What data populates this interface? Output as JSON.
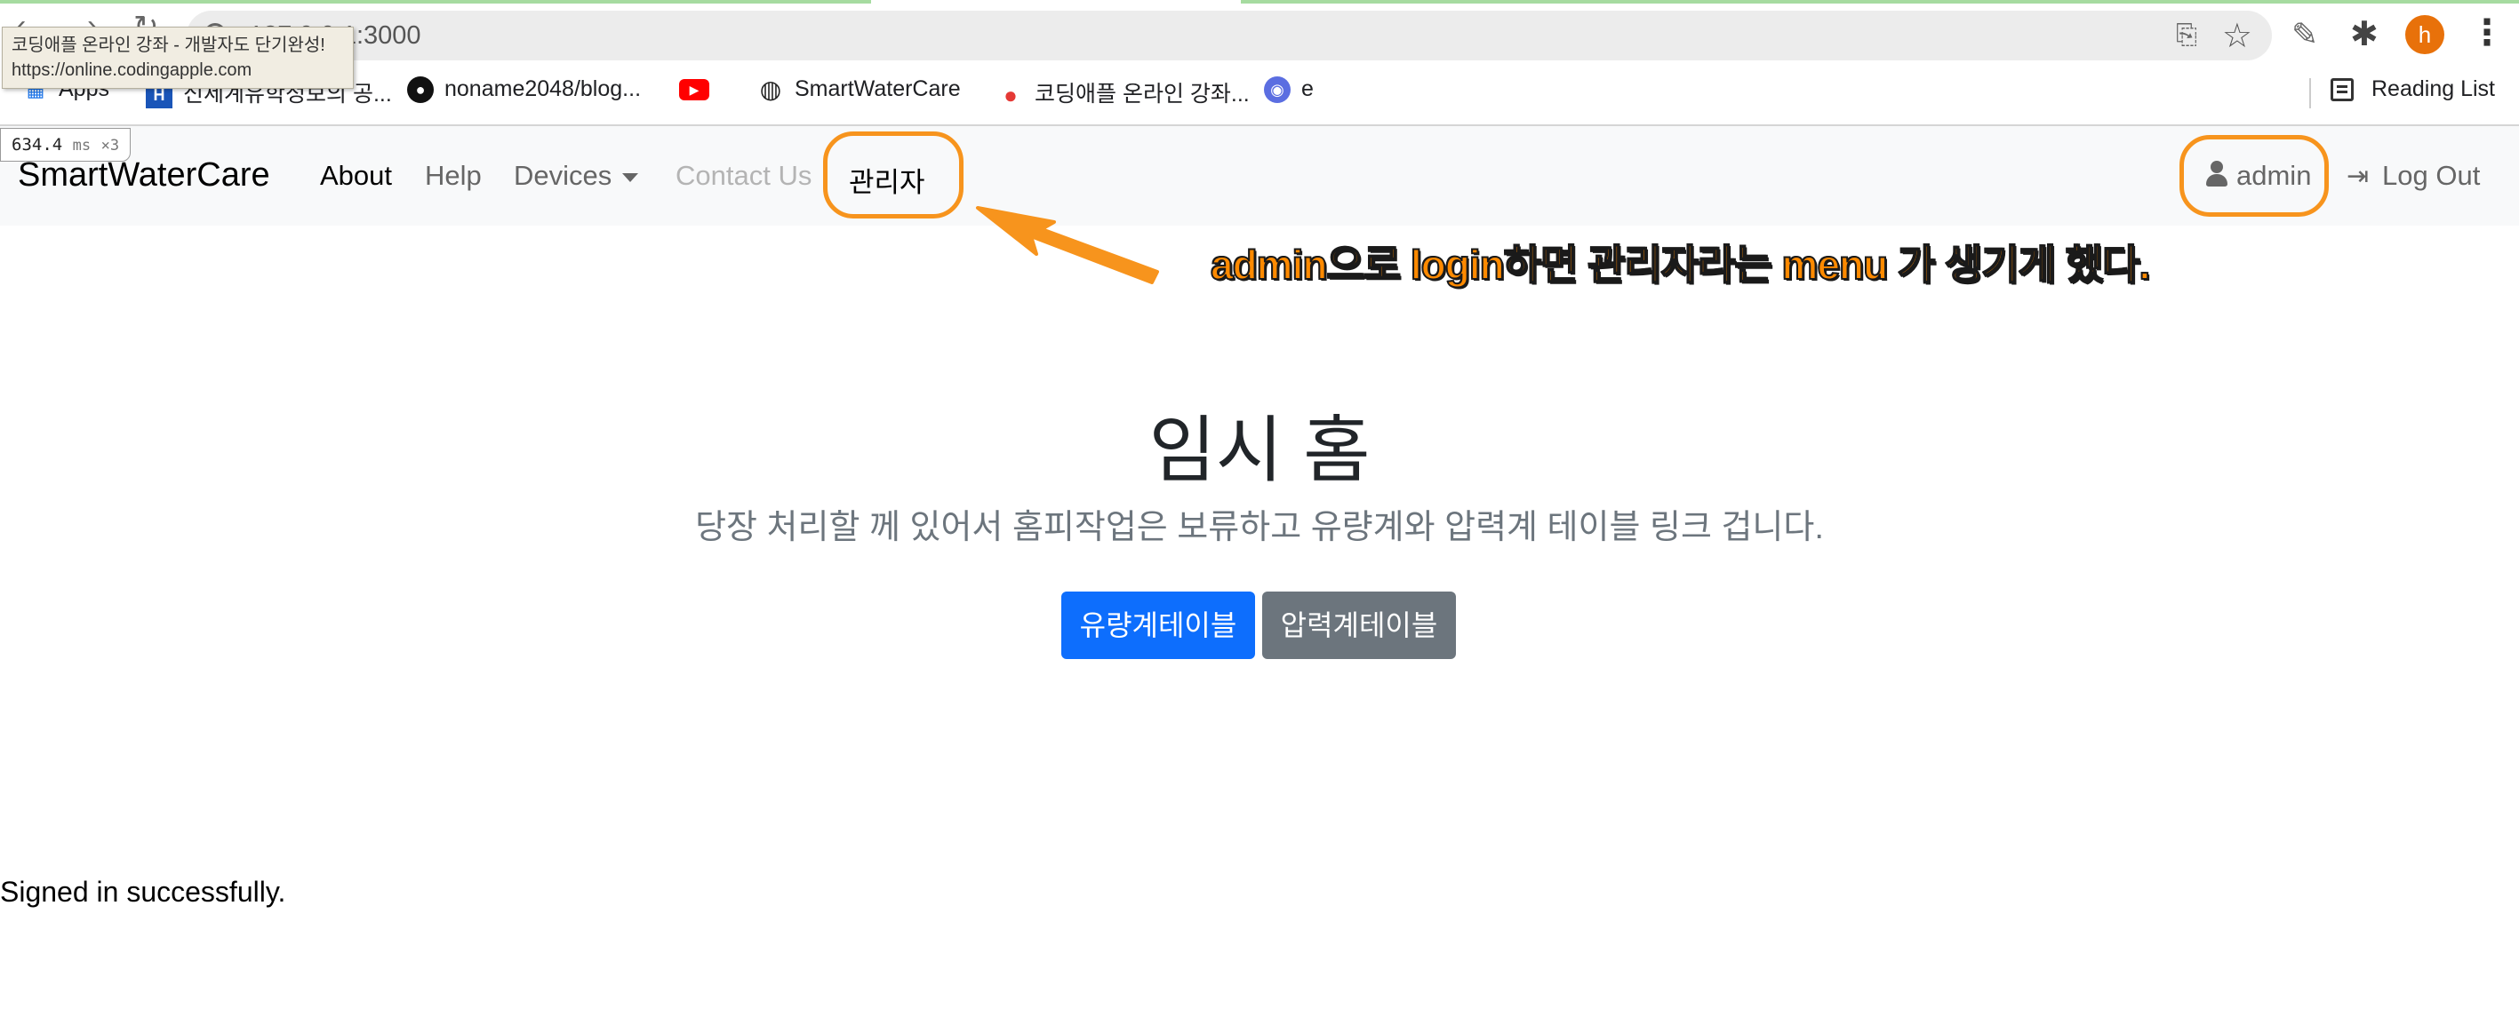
{
  "browser": {
    "address": "127.0.0.1:3000",
    "icons": [
      "back-icon",
      "forward-icon",
      "reload-icon",
      "info-icon",
      "translate-icon",
      "star-icon",
      "eyedropper-icon",
      "extensions-icon",
      "kebab-menu-icon"
    ],
    "profile_initial": "h",
    "profile_color": "#e8710a"
  },
  "tooltip": {
    "title": "코딩애플 온라인 강좌 - 개발자도 단기완성!",
    "url": "https://online.codingapple.com"
  },
  "perf": {
    "value": "634.4",
    "unit": "ms",
    "count": "×3"
  },
  "bookmarks": {
    "items": [
      {
        "label": "Apps",
        "icon": "apps-icon"
      },
      {
        "label": "신세계유학정보의 공...",
        "icon": "school-icon"
      },
      {
        "label": "noname2048/blog...",
        "icon": "github-icon"
      },
      {
        "label": "",
        "icon": "youtube-icon"
      },
      {
        "label": "SmartWaterCare",
        "icon": "globe-icon"
      },
      {
        "label": "코딩애플 온라인 강좌...",
        "icon": "apple-icon"
      },
      {
        "label": "e",
        "icon": "location-icon"
      }
    ],
    "reading_list": "Reading List"
  },
  "navbar": {
    "brand": "SmartWaterCare",
    "links": {
      "about": "About",
      "help": "Help",
      "devices": "Devices",
      "contact": "Contact Us",
      "admin_menu": "관리자"
    },
    "user": "admin",
    "logout": "Log Out"
  },
  "annotation": {
    "text": "admin으로 login하면 관리자라는 menu 가 생기게 했다.",
    "color": "#ff8a00",
    "highlight_color": "#f7941d"
  },
  "main": {
    "title": "임시 홈",
    "lead": "당장 처리할 께 있어서 홈피작업은 보류하고 유량계와 압력계 테이블 링크 겁니다.",
    "btn_flow": "유량계테이블",
    "btn_pressure": "압력계테이블",
    "primary_color": "#0d6efd",
    "secondary_color": "#6c757d"
  },
  "flash": "Signed in successfully."
}
